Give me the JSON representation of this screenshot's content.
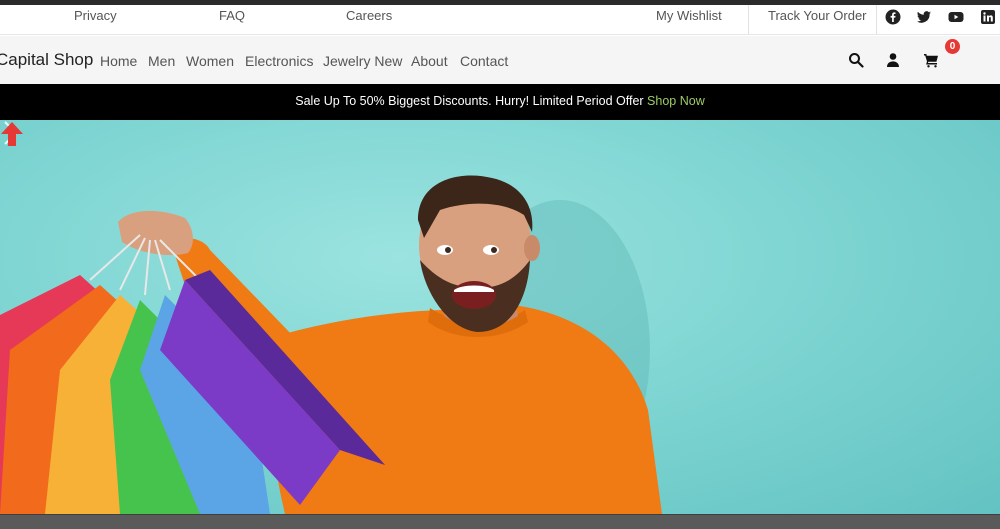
{
  "topbar": {
    "links": [
      "Privacy",
      "FAQ",
      "Careers"
    ],
    "wishlist": "My Wishlist",
    "track_order": "Track Your Order",
    "social_icons": [
      "facebook-icon",
      "twitter-icon",
      "youtube-icon",
      "linkedin-icon"
    ]
  },
  "navbar": {
    "brand": "Capital Shop",
    "links": [
      "Home",
      "Men",
      "Women",
      "Electronics",
      "Jewelry New",
      "About",
      "Contact"
    ],
    "cart_count": "0",
    "icons": [
      "search-icon",
      "user-icon",
      "cart-icon"
    ]
  },
  "promo": {
    "text": "Sale Up To 50% Biggest Discounts. Hurry! Limited Period Offer ",
    "link": "Shop Now"
  },
  "hero": {
    "background_color": "#80d6d3",
    "next_icon": "chevron-right-icon",
    "scroll_top_icon": "arrow-up-icon"
  },
  "colors": {
    "accent": "#9ccc65",
    "badge": "#e53935",
    "promo_bg": "#000000"
  }
}
